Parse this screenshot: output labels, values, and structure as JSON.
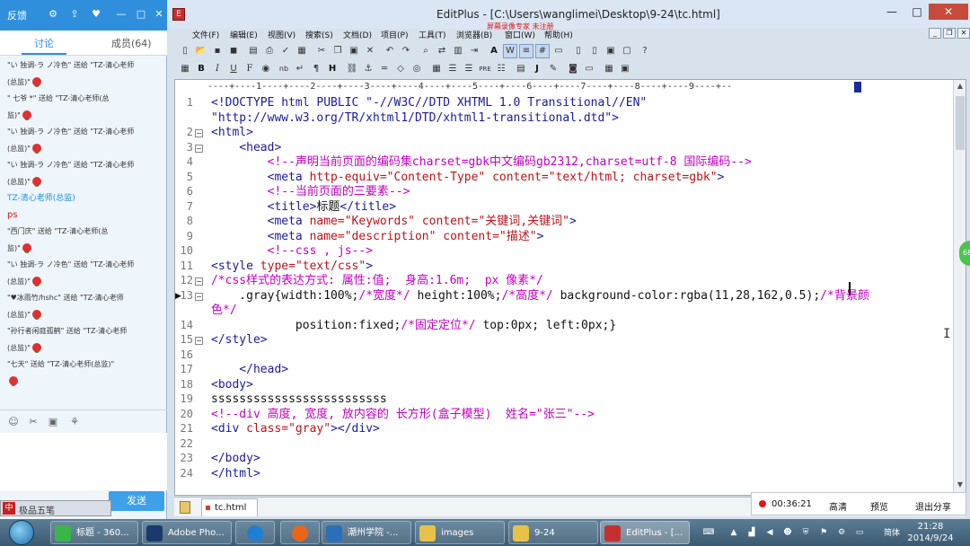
{
  "chat": {
    "feedback_label": "反馈",
    "tabs": [
      "讨论",
      "成员(64)"
    ],
    "messages": [
      {
        "text": "\"い 独调-ラ ノ冷色\" 送给 \"TZ-清心老师",
        "rose": false
      },
      {
        "text": "(总监)\"",
        "rose": true
      },
      {
        "text": "\"      七爷  *\" 送给 \"TZ-清心老师(总",
        "rose": false
      },
      {
        "text": "监)\"",
        "rose": true
      },
      {
        "text": "\"い 独调-ラ ノ冷色\" 送给 \"TZ-清心老师",
        "rose": false
      },
      {
        "text": "(总监)\"",
        "rose": true
      },
      {
        "text": "\"い 独调-ラ ノ冷色\" 送给 \"TZ-清心老师",
        "rose": false
      },
      {
        "text": "(总监)\"",
        "rose": true
      },
      {
        "text": "TZ-清心老师(总监)",
        "teacher": true
      },
      {
        "text": "ps",
        "ps": true
      },
      {
        "text": "\"西门庆\" 送给 \"TZ-清心老师(总",
        "rose": false
      },
      {
        "text": "监)\"",
        "rose": true
      },
      {
        "text": "\"い 独调-ラ ノ冷色\" 送给 \"TZ-清心老师",
        "rose": false
      },
      {
        "text": "(总监)\"",
        "rose": true
      },
      {
        "text": "\"♥冰雨竹/hshc\" 送给 \"TZ-清心老师",
        "rose": false
      },
      {
        "text": "(总监)\"",
        "rose": true
      },
      {
        "text": "\"孙行者闲庭孤鹤\" 送给 \"TZ-清心老师",
        "rose": false
      },
      {
        "text": "(总监)\"",
        "rose": true
      },
      {
        "text": "\"七天\" 送给 \"TZ-清心老师(总监)\"",
        "rose": false
      },
      {
        "text": "",
        "rose": true
      }
    ],
    "send_label": "发送",
    "ime_label": "极品五笔"
  },
  "editplus": {
    "title": "EditPlus - [C:\\Users\\wanglimei\\Desktop\\9-24\\tc.html]",
    "recorder_banner": "屏幕录像专家  未注册",
    "menu": [
      "文件(F)",
      "编辑(E)",
      "视图(V)",
      "搜索(S)",
      "文档(D)",
      "项目(P)",
      "工具(T)",
      "浏览器(B)",
      "窗口(W)",
      "帮助(H)"
    ],
    "ruler": "----+----1----+----2----+----3----+----4----+----5----+----6----+----7----+----8----+----9----+--",
    "tab_file": "tc.html",
    "recorder": {
      "time": "00:36:21",
      "quality": "高清",
      "preview": "预览",
      "exit_share": "退出分享"
    },
    "side_bubble": "68",
    "lines": [
      {
        "n": "1",
        "segs": [
          [
            "tag",
            "<!DOCTYPE html PUBLIC \"-//W3C//DTD XHTML 1.0 Transitional//EN\""
          ]
        ]
      },
      {
        "n": "",
        "segs": [
          [
            "tag",
            "\"http://www.w3.org/TR/xhtml1/DTD/xhtml1-transitional.dtd\">"
          ]
        ]
      },
      {
        "n": "2",
        "fold": true,
        "segs": [
          [
            "tag",
            "<html>"
          ]
        ]
      },
      {
        "n": "3",
        "fold": true,
        "segs": [
          [
            "tag",
            "    <head>"
          ]
        ]
      },
      {
        "n": "4",
        "segs": [
          [
            "cmt",
            "        <!--声明当前页面的编码集charset=gbk中文编码gb2312,charset=utf-8 国际编码-->"
          ]
        ]
      },
      {
        "n": "5",
        "segs": [
          [
            "tag",
            "        <meta "
          ],
          [
            "attr",
            "http-equiv="
          ],
          [
            "str",
            "\"Content-Type\""
          ],
          [
            "attr",
            " content="
          ],
          [
            "str",
            "\"text/html; charset=gbk\""
          ],
          [
            "tag",
            ">"
          ]
        ]
      },
      {
        "n": "6",
        "segs": [
          [
            "cmt",
            "        <!--当前页面的三要素-->"
          ]
        ]
      },
      {
        "n": "7",
        "segs": [
          [
            "tag",
            "        <title>"
          ],
          [
            "txt",
            "标题"
          ],
          [
            "tag",
            "</title>"
          ]
        ]
      },
      {
        "n": "8",
        "segs": [
          [
            "tag",
            "        <meta "
          ],
          [
            "attr",
            "name="
          ],
          [
            "str",
            "\"Keywords\""
          ],
          [
            "attr",
            " content="
          ],
          [
            "str",
            "\"关键词,关键词\""
          ],
          [
            "tag",
            ">"
          ]
        ]
      },
      {
        "n": "9",
        "segs": [
          [
            "tag",
            "        <meta "
          ],
          [
            "attr",
            "name="
          ],
          [
            "str",
            "\"description\""
          ],
          [
            "attr",
            " content="
          ],
          [
            "str",
            "\"描述\""
          ],
          [
            "tag",
            ">"
          ]
        ]
      },
      {
        "n": "10",
        "segs": [
          [
            "cmt",
            "        <!--css , js-->"
          ]
        ]
      },
      {
        "n": "11",
        "segs": [
          [
            "tag",
            "<style "
          ],
          [
            "attr",
            "type="
          ],
          [
            "str",
            "\"text/css\""
          ],
          [
            "tag",
            ">"
          ]
        ]
      },
      {
        "n": "12",
        "fold": true,
        "segs": [
          [
            "cmt",
            "/*css样式的表达方式: 属性:值;  身高:1.6m;  px 像素*/"
          ]
        ]
      },
      {
        "n": "13",
        "fold": true,
        "marker": true,
        "segs": [
          [
            "txt",
            "    .gray{width:100%;"
          ],
          [
            "cmt",
            "/*宽度*/"
          ],
          [
            "txt",
            " height:100%;"
          ],
          [
            "cmt",
            "/*高度*/"
          ],
          [
            "txt",
            " background-color:rgba(11,28,162,0.5);"
          ],
          [
            "cmt",
            "/*背景颜"
          ]
        ]
      },
      {
        "n": "",
        "segs": [
          [
            "cmt",
            "色*/"
          ]
        ]
      },
      {
        "n": "14",
        "segs": [
          [
            "txt",
            "            position:fixed;"
          ],
          [
            "cmt",
            "/*固定定位*/"
          ],
          [
            "txt",
            " top:0px; left:0px;}"
          ]
        ]
      },
      {
        "n": "15",
        "fold": true,
        "segs": [
          [
            "tag",
            "</style>"
          ]
        ]
      },
      {
        "n": "16",
        "segs": [
          [
            "txt",
            ""
          ]
        ]
      },
      {
        "n": "17",
        "segs": [
          [
            "tag",
            "    </head>"
          ]
        ]
      },
      {
        "n": "18",
        "segs": [
          [
            "tag",
            "<body>"
          ]
        ]
      },
      {
        "n": "19",
        "segs": [
          [
            "txt",
            "sssssssssssssssssssssssss"
          ]
        ]
      },
      {
        "n": "20",
        "segs": [
          [
            "cmt",
            "<!--div 高度, 宽度, 放内容的 长方形(盒子模型)  姓名=\"张三\"-->"
          ]
        ]
      },
      {
        "n": "21",
        "segs": [
          [
            "tag",
            "<div "
          ],
          [
            "attr",
            "class="
          ],
          [
            "str",
            "\"gray\""
          ],
          [
            "tag",
            "></div>"
          ]
        ]
      },
      {
        "n": "22",
        "segs": [
          [
            "txt",
            ""
          ]
        ]
      },
      {
        "n": "23",
        "segs": [
          [
            "tag",
            "</body>"
          ]
        ]
      },
      {
        "n": "24",
        "segs": [
          [
            "tag",
            "</html>"
          ]
        ]
      }
    ]
  },
  "taskbar": {
    "items": [
      {
        "label": "标题 - 360...",
        "color": "#3bb54a"
      },
      {
        "label": "Adobe Pho...",
        "color": "#1b3a6b"
      },
      {
        "label": "",
        "color": "#1f7fd4"
      },
      {
        "label": "",
        "color": "#e8661a"
      },
      {
        "label": "潮州学院 -...",
        "color": "#2a6fb8"
      },
      {
        "label": "images",
        "color": "#e8c248"
      },
      {
        "label": "9-24",
        "color": "#e8c248"
      },
      {
        "label": "EditPlus - [...",
        "color": "#c43030"
      }
    ],
    "ime_indicator": "简体",
    "clock_time": "21:28",
    "clock_date": "2014/9/24"
  }
}
